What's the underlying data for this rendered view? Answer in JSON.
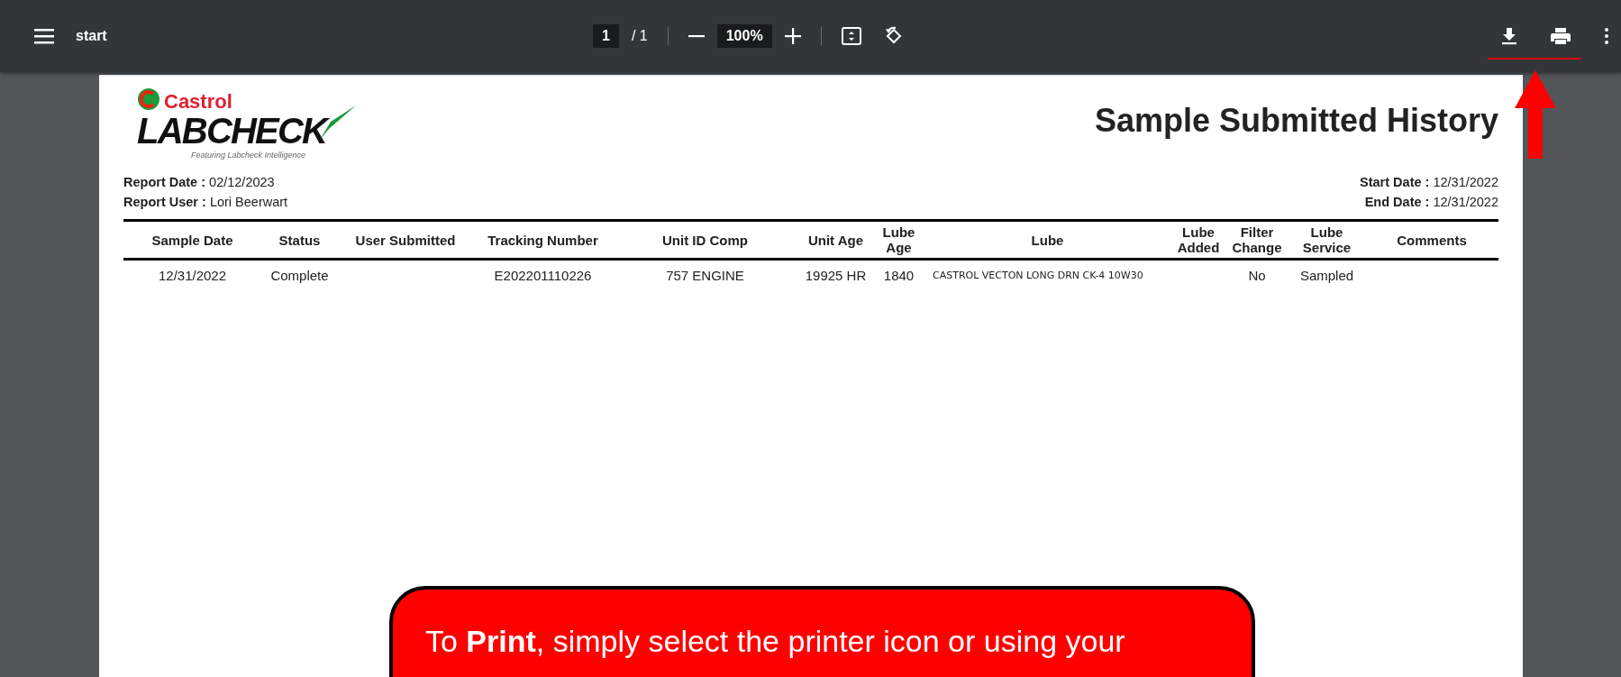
{
  "toolbar": {
    "title": "start",
    "page_field": "1",
    "page_total": "/ 1",
    "zoom_field": "100%"
  },
  "report": {
    "logo": {
      "brand": "Castrol",
      "product": "LABCHECK",
      "tagline": "Featuring Labcheck Intelligence"
    },
    "title": "Sample Submitted History",
    "meta_left": [
      {
        "label": "Report Date :",
        "value": "02/12/2023"
      },
      {
        "label": "Report User :",
        "value": "Lori Beerwart"
      }
    ],
    "meta_right": [
      {
        "label": "Start Date :",
        "value": "12/31/2022"
      },
      {
        "label": "End Date :",
        "value": "12/31/2022"
      }
    ],
    "table": {
      "columns": [
        "Sample Date",
        "Status",
        "User Submitted",
        "Tracking Number",
        "Unit ID Comp",
        "Unit Age",
        "Lube Age",
        "Lube",
        "Lube Added",
        "Filter Change",
        "Lube Service",
        "Comments"
      ],
      "rows": [
        [
          "12/31/2022",
          "Complete",
          "",
          "E202201110226",
          "757 ENGINE",
          "19925 HR",
          "1840",
          "CASTROL VECTON LONG DRN CK-4 10W30",
          "",
          "No",
          "Sampled",
          ""
        ]
      ]
    }
  },
  "callout": {
    "text": "To **Print**, simply select the printer icon or using your"
  }
}
